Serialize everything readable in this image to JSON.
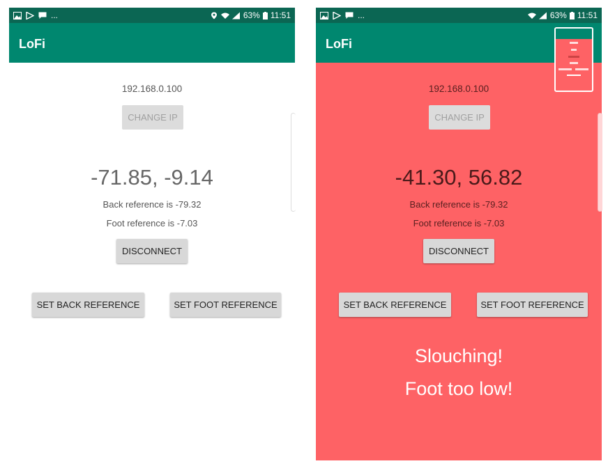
{
  "screens": [
    {
      "status": {
        "signal_text": "63%",
        "time": "11:51",
        "notif_overflow": "..."
      },
      "app_title": "LoFi",
      "ip": "192.168.0.100",
      "change_ip_label": "CHANGE IP",
      "reading": "-71.85, -9.14",
      "back_reference": "Back reference is -79.32",
      "foot_reference": "Foot reference is -7.03",
      "disconnect_label": "DISCONNECT",
      "set_back_label": "SET BACK REFERENCE",
      "set_foot_label": "SET FOOT REFERENCE",
      "background_color": "#ffffff",
      "icons": [
        "gallery-icon",
        "play-store-icon",
        "chat-icon",
        "location-icon",
        "wifi-icon",
        "signal-icon",
        "battery-icon"
      ]
    },
    {
      "status": {
        "signal_text": "63%",
        "time": "11:51",
        "notif_overflow": "..."
      },
      "app_title": "LoFi",
      "ip": "192.168.0.100",
      "change_ip_label": "CHANGE IP",
      "reading": "-41.30, 56.82",
      "back_reference": "Back reference is -79.32",
      "foot_reference": "Foot reference is -7.03",
      "disconnect_label": "DISCONNECT",
      "set_back_label": "SET BACK REFERENCE",
      "set_foot_label": "SET FOOT REFERENCE",
      "alert_line1": "Slouching!",
      "alert_line2": "Foot too low!",
      "background_color": "#fe6265",
      "icons": [
        "gallery-icon",
        "play-store-icon",
        "chat-icon",
        "wifi-icon",
        "signal-icon",
        "battery-icon"
      ]
    }
  ],
  "colors": {
    "status_bar": "#0b6653",
    "app_bar": "#00876f",
    "alert_bg": "#fe6265",
    "button": "#d8d8d8"
  }
}
